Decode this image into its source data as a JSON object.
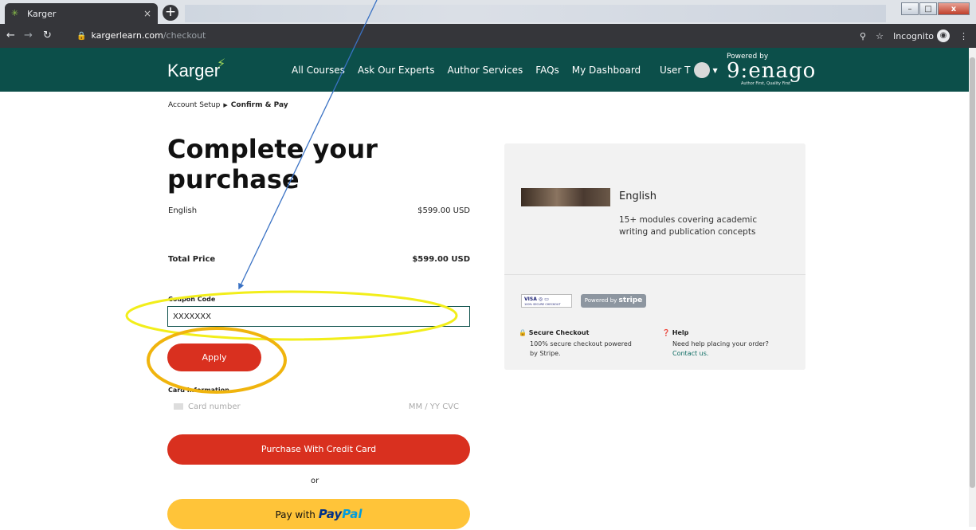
{
  "browser": {
    "tab_title": "Karger",
    "tab_close": "×",
    "new_tab": "+",
    "url_host": "kargerlearn.com",
    "url_path": "/checkout",
    "incognito_label": "Incognito",
    "window_min": "–",
    "window_max": "□",
    "window_close": "x"
  },
  "header": {
    "logo_text": "Karger",
    "nav": [
      "All Courses",
      "Ask Our Experts",
      "Author Services",
      "FAQs",
      "My Dashboard"
    ],
    "user_name": "User T",
    "enago_powered": "Powered by",
    "enago_name": "enago",
    "enago_tagline": "Author First, Quality First",
    "brand_color": "#0c4f4a"
  },
  "breadcrumb": {
    "step1": "Account Setup",
    "step2": "Confirm & Pay"
  },
  "checkout": {
    "title": "Complete your purchase",
    "item_name": "English",
    "item_price": "$599.00 USD",
    "total_label": "Total Price",
    "total_price": "$599.00 USD",
    "coupon_label": "Coupon Code",
    "coupon_value": "XXXXXXX",
    "apply_label": "Apply",
    "card_label": "Card Information",
    "card_placeholder": "Card number",
    "card_exp_cvc": "MM / YY  CVC",
    "purchase_label": "Purchase With Credit Card",
    "or_text": "or",
    "paypal_prefix": "Pay with",
    "paypal_word1": "Pay",
    "paypal_word2": "Pal",
    "accent_color": "#d9301f"
  },
  "summary": {
    "product_name": "English",
    "product_desc": "15+ modules covering academic writing and publication concepts",
    "cards_badge": "VISA",
    "cards_badge_sub": "100% SECURE CHECKOUT",
    "stripe_prefix": "Powered by",
    "stripe_name": "stripe",
    "secure_title": "Secure Checkout",
    "secure_body": "100% secure checkout powered by Stripe.",
    "help_title": "Help",
    "help_body": "Need help placing your order?",
    "help_link": "Contact us."
  }
}
